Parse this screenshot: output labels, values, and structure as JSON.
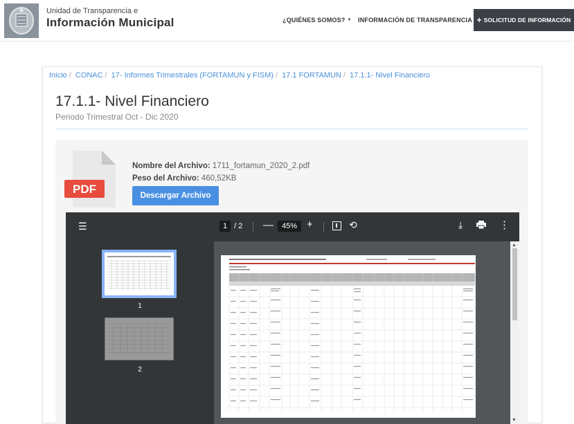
{
  "header": {
    "brand_small": "Unidad de Transparencia e",
    "brand_big": "Información Municipal",
    "nav": [
      {
        "label": "¿QUIÉNES SOMOS?"
      },
      {
        "label": "INFORMACIÓN DE TRANSPARENCIA"
      }
    ],
    "cta_label": "SOLICITUD DE INFORMACIÓN"
  },
  "breadcrumb": [
    "Inicio",
    "CONAC",
    "17- Informes Trimestrales (FORTAMUN y FISM)",
    "17.1 FORTAMUN",
    "17.1.1- Nivel Financiero"
  ],
  "page": {
    "title": "17.1.1- Nivel Financiero",
    "subtitle": "Periodo Trimestral Oct - Dic 2020"
  },
  "file": {
    "icon_label": "PDF",
    "name_label": "Nombre del Archivo:",
    "name_value": "1711_fortamun_2020_2.pdf",
    "size_label": "Peso del Archivo:",
    "size_value": "460,52KB",
    "download_label": "Descargar Archivo"
  },
  "viewer": {
    "current_page": "1",
    "total_pages": "/ 2",
    "zoom": "45%",
    "thumbnails": [
      {
        "number": "1"
      },
      {
        "number": "2"
      }
    ]
  },
  "colors": {
    "accent": "#4a90e2",
    "pdf_red": "#e74c3c",
    "toolbar": "#323639",
    "link": "#4a90d9"
  }
}
